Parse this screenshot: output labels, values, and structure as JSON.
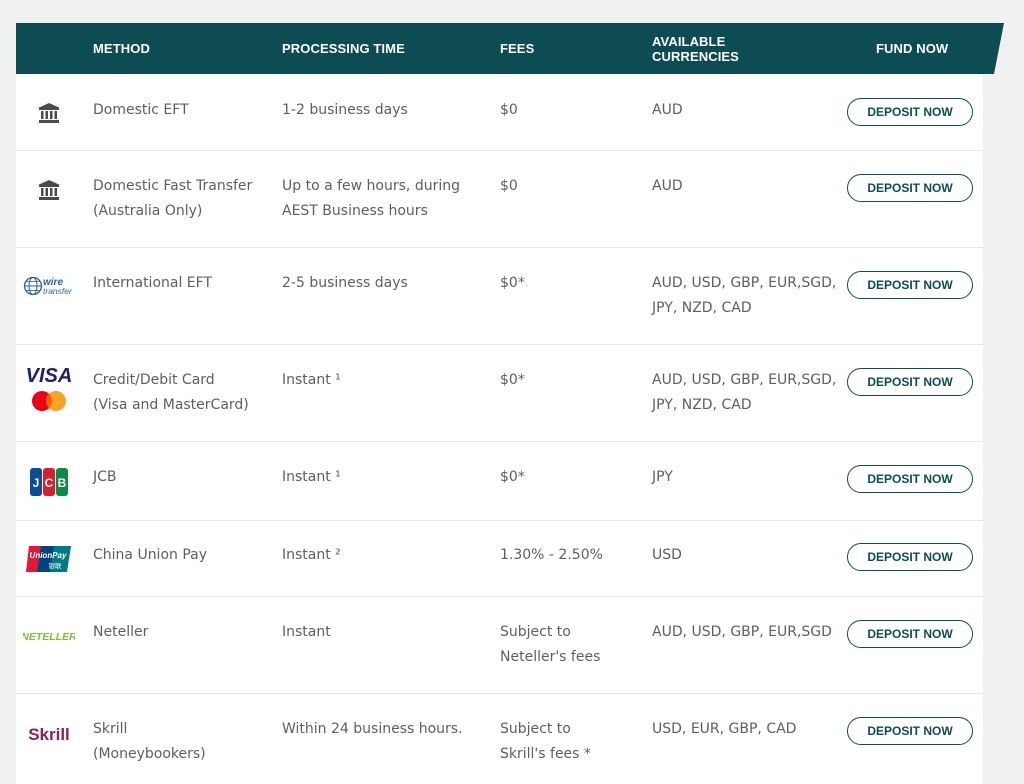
{
  "header": {
    "method": "METHOD",
    "processing_time": "PROCESSING TIME",
    "fees": "FEES",
    "currencies_line1": "AVAILABLE",
    "currencies_line2": "CURRENCIES",
    "fund_now": "FUND NOW"
  },
  "colors": {
    "header_bg": "#0e4c53",
    "button_border": "#0e4c53",
    "visa_blue": "#1a1f71",
    "mastercard_red": "#eb001b",
    "mastercard_orange": "#f79e1b",
    "neteller_green": "#83ba3b",
    "skrill_purple": "#862165"
  },
  "rows": [
    {
      "icon": "bank-icon",
      "method_line1": "Domestic EFT",
      "method_line2": "",
      "time_line1": "1-2 business days",
      "time_line2": "",
      "fees_line1": "$0",
      "fees_line2": "",
      "currencies_line1": "AUD",
      "currencies_line2": "",
      "button": "DEPOSIT NOW"
    },
    {
      "icon": "bank-icon",
      "method_line1": "Domestic Fast Transfer",
      "method_line2": "(Australia Only)",
      "time_line1": "Up to a few hours, during",
      "time_line2": "AEST Business hours",
      "fees_line1": "$0",
      "fees_line2": "",
      "currencies_line1": "AUD",
      "currencies_line2": "",
      "button": "DEPOSIT NOW"
    },
    {
      "icon": "wire-transfer-logo",
      "logo_text_line1": "wire",
      "logo_text_line2": "transfer",
      "method_line1": "International EFT",
      "method_line2": "",
      "time_line1": "2-5 business days",
      "time_line2": "",
      "fees_line1": "$0*",
      "fees_line2": "",
      "currencies_line1": "AUD, USD, GBP, EUR,SGD,",
      "currencies_line2": "JPY, NZD, CAD",
      "button": "DEPOSIT NOW"
    },
    {
      "icon": "visa-mastercard-logo",
      "logo_text": "VISA",
      "method_line1": "Credit/Debit Card",
      "method_line2": "(Visa and MasterCard)",
      "time_line1": "Instant ¹",
      "time_line2": "",
      "fees_line1": "$0*",
      "fees_line2": "",
      "currencies_line1": "AUD, USD, GBP, EUR,SGD,",
      "currencies_line2": "JPY, NZD, CAD",
      "button": "DEPOSIT NOW"
    },
    {
      "icon": "jcb-logo",
      "logo_letters": [
        "J",
        "C",
        "B"
      ],
      "method_line1": "JCB",
      "method_line2": "",
      "time_line1": "Instant ¹",
      "time_line2": "",
      "fees_line1": "$0*",
      "fees_line2": "",
      "currencies_line1": "JPY",
      "currencies_line2": "",
      "button": "DEPOSIT NOW"
    },
    {
      "icon": "unionpay-logo",
      "logo_text_line1": "UnionPay",
      "logo_text_line2": "银联",
      "method_line1": "China Union Pay",
      "method_line2": "",
      "time_line1": "Instant ²",
      "time_line2": "",
      "fees_line1": "1.30% - 2.50%",
      "fees_line2": "",
      "currencies_line1": "USD",
      "currencies_line2": "",
      "button": "DEPOSIT NOW"
    },
    {
      "icon": "neteller-logo",
      "logo_text": "NETELLER",
      "method_line1": "Neteller",
      "method_line2": "",
      "time_line1": "Instant",
      "time_line2": "",
      "fees_line1": "Subject to",
      "fees_line2": "Neteller's fees",
      "currencies_line1": "AUD, USD, GBP, EUR,SGD",
      "currencies_line2": "",
      "button": "DEPOSIT NOW"
    },
    {
      "icon": "skrill-logo",
      "logo_text": "Skrill",
      "method_line1": "Skrill",
      "method_line2": "(Moneybookers)",
      "time_line1": "Within 24 business hours.",
      "time_line2": "",
      "fees_line1": "Subject to",
      "fees_line2": "Skrill's fees *",
      "currencies_line1": "USD, EUR, GBP, CAD",
      "currencies_line2": "",
      "button": "DEPOSIT NOW"
    }
  ]
}
